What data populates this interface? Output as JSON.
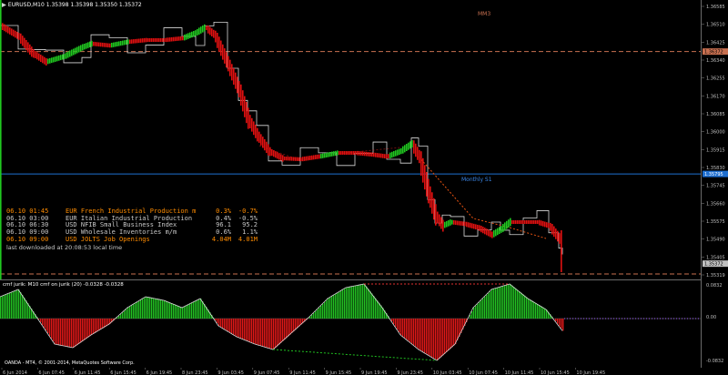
{
  "header": {
    "symbol_label": "EURUSD,M10",
    "ohlc": "1.35398 1.35398 1.35350 1.35372"
  },
  "price_axis": {
    "labels": [
      "1.36585",
      "1.36510",
      "1.36425",
      "1.36340",
      "1.36255",
      "1.36170",
      "1.36085",
      "1.36000",
      "1.35915",
      "1.35830",
      "1.35745",
      "1.35660",
      "1.35575",
      "1.35490",
      "1.35405",
      "1.35319"
    ],
    "current_price": "1.35372",
    "mm3_price": "1.36372",
    "s1_price": "1.35795",
    "current_price_color": "#c0c0c0",
    "s1_color": "#1f6fd0"
  },
  "levels": {
    "mm3_label": "MM3",
    "s1_label": "Monthly S1",
    "mm3_color": "#c87050",
    "s1_color": "#1f6fd0"
  },
  "news": {
    "rows": [
      {
        "time": "06.10 01:45",
        "event": "EUR French Industrial Production m",
        "actual": "0.3%",
        "prev": "-0.7%",
        "color": "#ff8c00"
      },
      {
        "time": "06.10 03:00",
        "event": "EUR Italian Industrial Production",
        "actual": "0.4%",
        "prev": "-0.5%",
        "color": "#c8c8c8"
      },
      {
        "time": "06.10 06:30",
        "event": "USD NFIB Small Business Index",
        "actual": "96.1",
        "prev": "95.2",
        "color": "#c8c8c8"
      },
      {
        "time": "06.10 09:00",
        "event": "USD Wholesale Inventories m/m",
        "actual": "0.6%",
        "prev": "1.1%",
        "color": "#c8c8c8"
      },
      {
        "time": "06.10 09:00",
        "event": "USD JOLTS Job Openings",
        "actual": "4.04M",
        "prev": "4.01M",
        "color": "#ff8c00"
      }
    ],
    "footer": "last downloaded at 20:08:53 local time"
  },
  "indicator": {
    "title": "cmf jurik: M10   cmf on jurik (20) -0.0328 -0.0328",
    "axis_labels": [
      "0.0832",
      "0.00",
      "-0.0832"
    ],
    "up_color": "#22c222",
    "down_color": "#e01818"
  },
  "copyright": "OANDA - MT4, © 2001-2014, MetaQuotes Software Corp.",
  "time_axis": {
    "labels": [
      "6 Jun 2014",
      "6 Jun 07:45",
      "6 Jun 11:45",
      "6 Jun 15:45",
      "6 Jun 19:45",
      "8 Jun 23:45",
      "9 Jun 03:45",
      "9 Jun 07:45",
      "9 Jun 11:45",
      "9 Jun 15:45",
      "9 Jun 19:45",
      "9 Jun 23:45",
      "10 Jun 03:45",
      "10 Jun 07:45",
      "10 Jun 11:45",
      "10 Jun 15:45",
      "10 Jun 19:45"
    ]
  }
}
